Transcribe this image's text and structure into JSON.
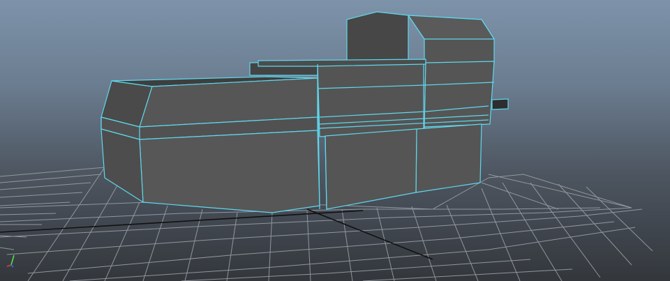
{
  "viewport": {
    "view": "perspective",
    "grid_visible": true,
    "selection_highlight": true
  },
  "colors": {
    "sky_top": "#7d93aa",
    "ground": "#33373c",
    "grid_line": "#9aa0a6",
    "grid_axis": "#111111",
    "mesh_face": "#555555",
    "mesh_face_dark": "#464646",
    "wireframe_highlight": "#5fd8ee",
    "axis_x": "#e23b3b",
    "axis_y": "#4fe04f",
    "axis_z": "#3b6be2"
  },
  "gizmo": {
    "axes": [
      "x",
      "y",
      "z"
    ]
  }
}
